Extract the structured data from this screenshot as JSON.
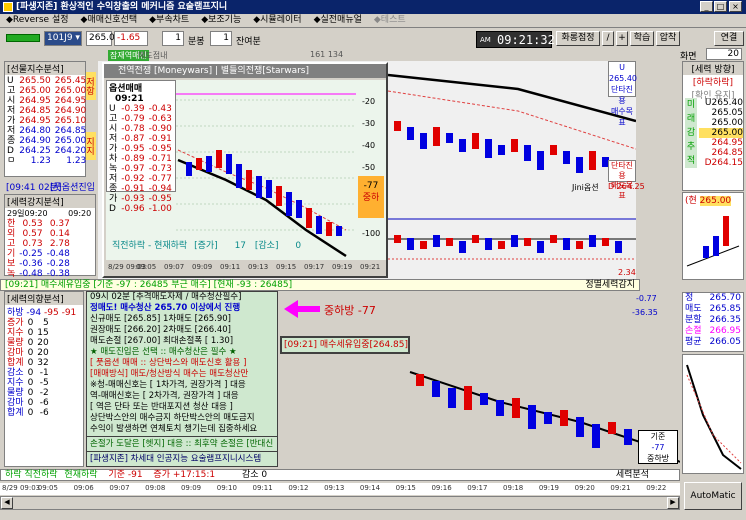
{
  "window": {
    "title": "[파생지존] 환상적인 수익창출의 메커니즘 요술램프지니"
  },
  "menu": [
    "◆Reverse 설정",
    "◆매매신호선택",
    "◆부속차트",
    "◆보조기능",
    "◆시뮬레이터",
    "◆실전매뉴얼",
    "◆테스트"
  ],
  "toolbar": {
    "code": "101J9",
    "price": "265.00",
    "change": "-1.65",
    "qty": "1",
    "unit": "분봉",
    "qty2": "1",
    "remain": "잔여분",
    "clock_label": "AM",
    "clock": "09:21:32",
    "buttons": [
      "화롱점정",
      "/",
      "+",
      "학",
      "압",
      "연결"
    ],
    "screen_label": "화면",
    "screen_no": "20"
  },
  "tabs": [
    "잠재역매신",
    "매도점내",
    "오반산매",
    "추세일편체",
    "원멀비원",
    "선물현매신",
    "사용차건",
    "추세",
    "반은선평",
    "마지엠영화",
    "161 134"
  ],
  "futures_panel": {
    "title": "[선물지수분석]",
    "rows": [
      [
        "U",
        "265.50",
        "265.45"
      ],
      [
        "고",
        "265.00",
        "265.00"
      ],
      [
        "시",
        "264.95",
        "264.95"
      ],
      [
        "저",
        "264.85",
        "264.90"
      ],
      [
        "가",
        "264.95",
        "265.10"
      ],
      [
        "저",
        "264.80",
        "264.85"
      ],
      [
        "종",
        "264.90",
        "265.00"
      ],
      [
        "D",
        "264.25",
        "264.20"
      ],
      [
        "ㅁ",
        "1.23",
        "1.23"
      ]
    ],
    "side": "저항",
    "side2": "지지"
  },
  "entry": {
    "time": "[09:41 02분]",
    "label": "[풋옵션진입"
  },
  "strength": {
    "title": "[세력강지분석]",
    "time": "29일09:20",
    "time2": "09:20",
    "rows": [
      [
        "한",
        "0.53",
        "0.37"
      ],
      [
        "외",
        "0.57",
        "0.14"
      ],
      [
        "고",
        "0.73",
        "2.78"
      ],
      [
        "기",
        "-0.25",
        "-0.48"
      ],
      [
        "보",
        "-0.36",
        "-0.28"
      ],
      [
        "녹",
        "-0.48",
        "-0.38"
      ]
    ]
  },
  "status_line": "[09:21] 매수세유입중 [기준 -97 : 26485 부근 매수] [현재 -93 : 26485]",
  "status_right": "정멸세력감지",
  "popup": {
    "title": "전역전쟁 [Moneywars] | 별들의전쟁[Starwars]",
    "header": [
      "옵션매매",
      "09:21"
    ],
    "rows": [
      [
        "U",
        "-0.39",
        "-0.43"
      ],
      [
        "고",
        "-0.79",
        "-0.63"
      ],
      [
        "시",
        "-0.78",
        "-0.90"
      ],
      [
        "저",
        "-0.87",
        "-0.91"
      ],
      [
        "가",
        "-0.95",
        "-0.95"
      ],
      [
        "차",
        "-0.89",
        "-0.71"
      ],
      [
        "녹",
        "-0.97",
        "-0.73"
      ],
      [
        "저",
        "-0.92",
        "-0.77"
      ],
      [
        "종",
        "-0.91",
        "-0.94"
      ],
      [
        "가",
        "-0.93",
        "-0.95"
      ],
      [
        "D",
        "-0.96",
        "-1.00"
      ]
    ],
    "yticks": [
      "-20",
      "-30",
      "-40",
      "-50",
      "-60",
      "-77",
      "-100"
    ],
    "label1": "-77",
    "label2": "중하",
    "footer_left": "직전하락 - 현재하락",
    "footer_a": "[증가]",
    "footer_b": "17",
    "footer_c": "[감소]",
    "footer_d": "0",
    "xticks": [
      "8/29 09:03",
      "09:05",
      "09:07",
      "09:09",
      "09:11",
      "09:13",
      "09:15",
      "09:17",
      "09:19",
      "09:21"
    ]
  },
  "mid_chart": {
    "label1": "Jini옵션",
    "label2": "D 264.25",
    "label3": "2.34",
    "top_right": [
      "U 265.40",
      "단타진용",
      "매수목표"
    ],
    "mid_right": [
      "단타진용",
      "매도목표"
    ]
  },
  "right_panel": {
    "title": "[세력 방향]",
    "sub1": "[하락하락]",
    "sub2": "[확인 유지]",
    "side_labels": [
      "미",
      "래",
      "감",
      "추",
      "적"
    ],
    "rows": [
      "U265.40",
      "265.05",
      "265.00",
      "265.00",
      "264.95",
      "264.85",
      "D264.15"
    ],
    "cur": "265.00",
    "cur_label": "(현"
  },
  "bottom_left": {
    "title": "[세력의향분석]",
    "header": [
      "하방 -94",
      "-95",
      "-91"
    ],
    "rows": [
      [
        "증가",
        "0",
        "5"
      ],
      [
        "지수",
        "0",
        "15"
      ],
      [
        "물량",
        "0",
        "20"
      ],
      [
        "감마",
        "0",
        "20"
      ],
      [
        "합계",
        "0",
        "32"
      ],
      [
        "감소",
        "0",
        "-1"
      ],
      [
        "지수",
        "0",
        "-5"
      ],
      [
        "물량",
        "0",
        "-2"
      ],
      [
        "감마",
        "0",
        "-6"
      ],
      [
        "합계",
        "0",
        "-6"
      ]
    ]
  },
  "strategy": {
    "line1": "09시 02분 [추격매도자제 / 매수청산필수]",
    "line2": "정매도! 매수청산 265.70 이상에서 진행",
    "line3": "신규매도 [265.85]  1차매도 [265.90]",
    "line4": "권장매도 [266.20]  2차매도 [266.40]",
    "line5": "매도손절 [267.00]  최대손절폭 [ 1.30]",
    "line6": "★ 매도진입은 선택 :: 매수청산은 필수 ★",
    "line7": "[ 풋옵션 매매 :: 상단박스와 매도신호 활용 ]",
    "line8": "[매매방식] 매도/청산방식 매수는 매도청산만",
    "line9": "※청-매매신호는 [ 1차가격, 권장가격 ] 대응",
    "line10": "역-매매신호는 [ 2차가격, 권장가격 ] 대응",
    "line11": "[ 역은 단타 또는 반대포지션 청산 대응 ]",
    "line12": "상단박스안의 매수금지 하단박스안의 매도금지",
    "line13": "수익이 발생하면 연체토치 챙기는데 집중하세요",
    "footer1": "손절가 도달은 [헷지] 대응 :: 최후약 손절은 [반대신호발생]",
    "footer2": "[파생지존] 차세대 인공지능 요술램프지니시스템"
  },
  "arrow_label": "중하방 -77",
  "inflow_label": "[09:21] 매수세유입중[264.85]",
  "bottom_chart": {
    "v1": "-0.77",
    "v2": "-36.35",
    "box1": "기준",
    "box2": "-77",
    "box3": "중하방"
  },
  "bottom_right": {
    "rows": [
      [
        "정",
        "265.70"
      ],
      [
        "매도",
        "265.85"
      ],
      [
        "분할",
        "266.35"
      ],
      [
        "손절",
        "266.95"
      ],
      [
        "평균",
        "266.05"
      ]
    ]
  },
  "footer": {
    "text1": "하락 직전하락",
    "text2": "현재하락",
    "text3": "기준 -91",
    "text4": "증가 +17:15:1",
    "text5": "감소 0",
    "text6": "세력분석",
    "xticks": [
      "8/29 09:03",
      "09:05",
      "09:06",
      "09:07",
      "09:08",
      "09:09",
      "09:10",
      "09:11",
      "09:12",
      "09:13",
      "09:14",
      "09:15",
      "09:16",
      "09:17",
      "09:18",
      "09:19",
      "09:20",
      "09:21",
      "09:22"
    ],
    "automatic": "AutoMatic"
  },
  "colors": {
    "title_bg": "#0a246a",
    "up": "#e00000",
    "down": "#0000e0",
    "panel_green": "#cfe8cf",
    "magenta": "#ff00ff"
  }
}
